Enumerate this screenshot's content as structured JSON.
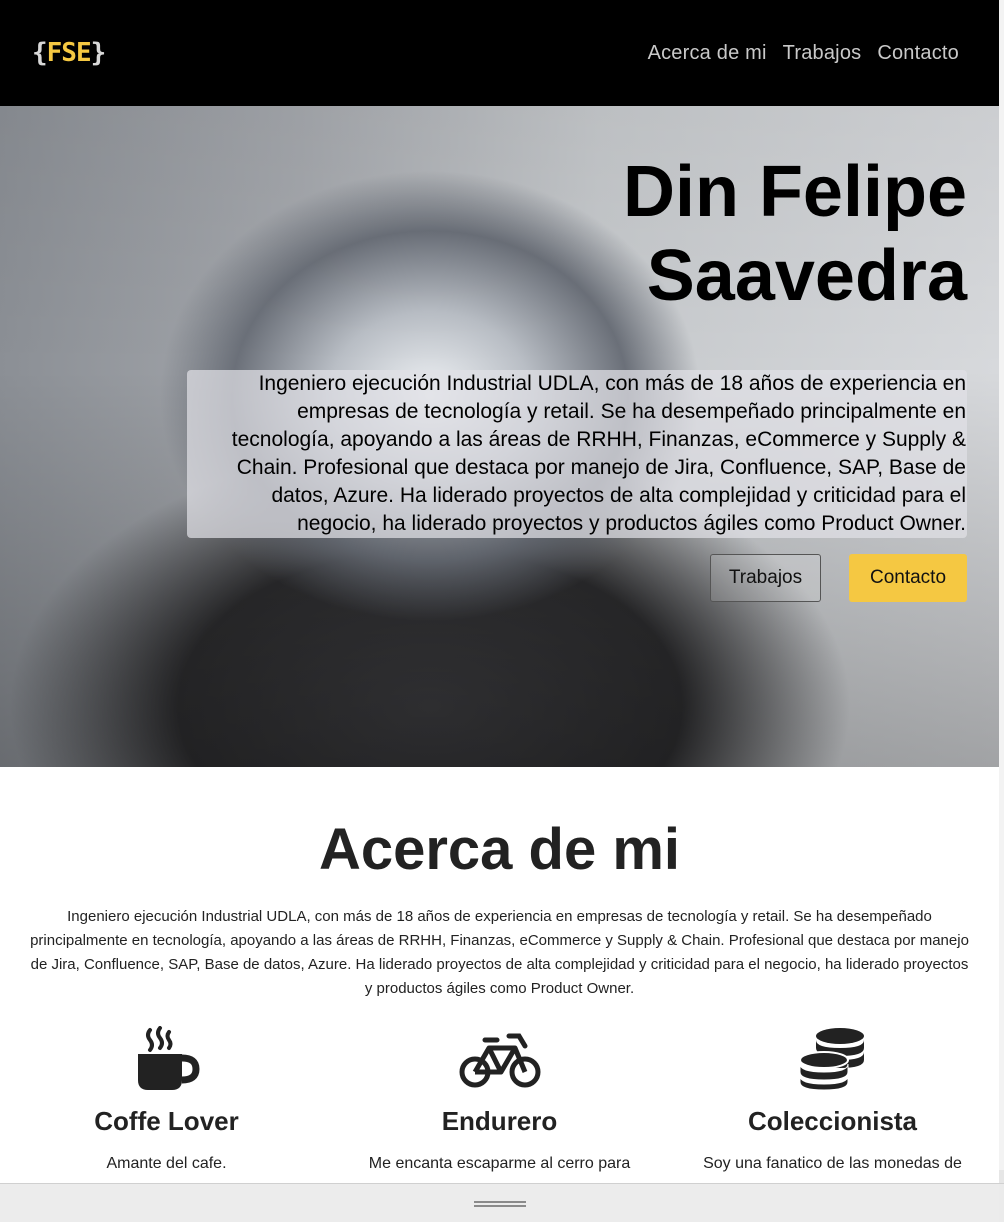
{
  "nav": {
    "logo_left_brace": "{",
    "logo_text": "FSE",
    "logo_right_brace": "}",
    "links": [
      "Acerca de mi",
      "Trabajos",
      "Contacto"
    ]
  },
  "hero": {
    "title_line1": "Din Felipe",
    "title_line2": "Saavedra",
    "description": "Ingeniero ejecución Industrial UDLA, con más de 18 años de experiencia en empresas de tecnología y retail. Se ha desempeñado principalmente en tecnología, apoyando a las áreas de RRHH, Finanzas, eCommerce y Supply & Chain. Profesional que destaca por manejo de Jira, Confluence, SAP, Base de datos, Azure. Ha liderado proyectos de alta complejidad y criticidad para el negocio, ha liderado proyectos y productos ágiles como Product Owner.",
    "btn_works": "Trabajos",
    "btn_contact": "Contacto"
  },
  "about": {
    "title": "Acerca de mi",
    "text": "Ingeniero ejecución Industrial UDLA, con más de 18 años de experiencia en empresas de tecnología y retail. Se ha desempeñado principalmente en tecnología, apoyando a las áreas de RRHH, Finanzas, eCommerce y Supply & Chain. Profesional que destaca por manejo de Jira, Confluence, SAP, Base de datos, Azure. Ha liderado proyectos de alta complejidad y criticidad para el negocio, ha liderado proyectos y productos ágiles como Product Owner."
  },
  "features": [
    {
      "icon": "coffee-mug-icon",
      "title": "Coffe Lover",
      "text": "Amante del cafe."
    },
    {
      "icon": "bicycle-icon",
      "title": "Endurero",
      "text": "Me encanta escaparme al cerro para"
    },
    {
      "icon": "coins-stack-icon",
      "title": "Coleccionista",
      "text": "Soy una fanatico de las monedas de"
    }
  ],
  "colors": {
    "accent": "#f5c842",
    "nav_bg": "#000000",
    "nav_link": "#c9c9c9"
  }
}
